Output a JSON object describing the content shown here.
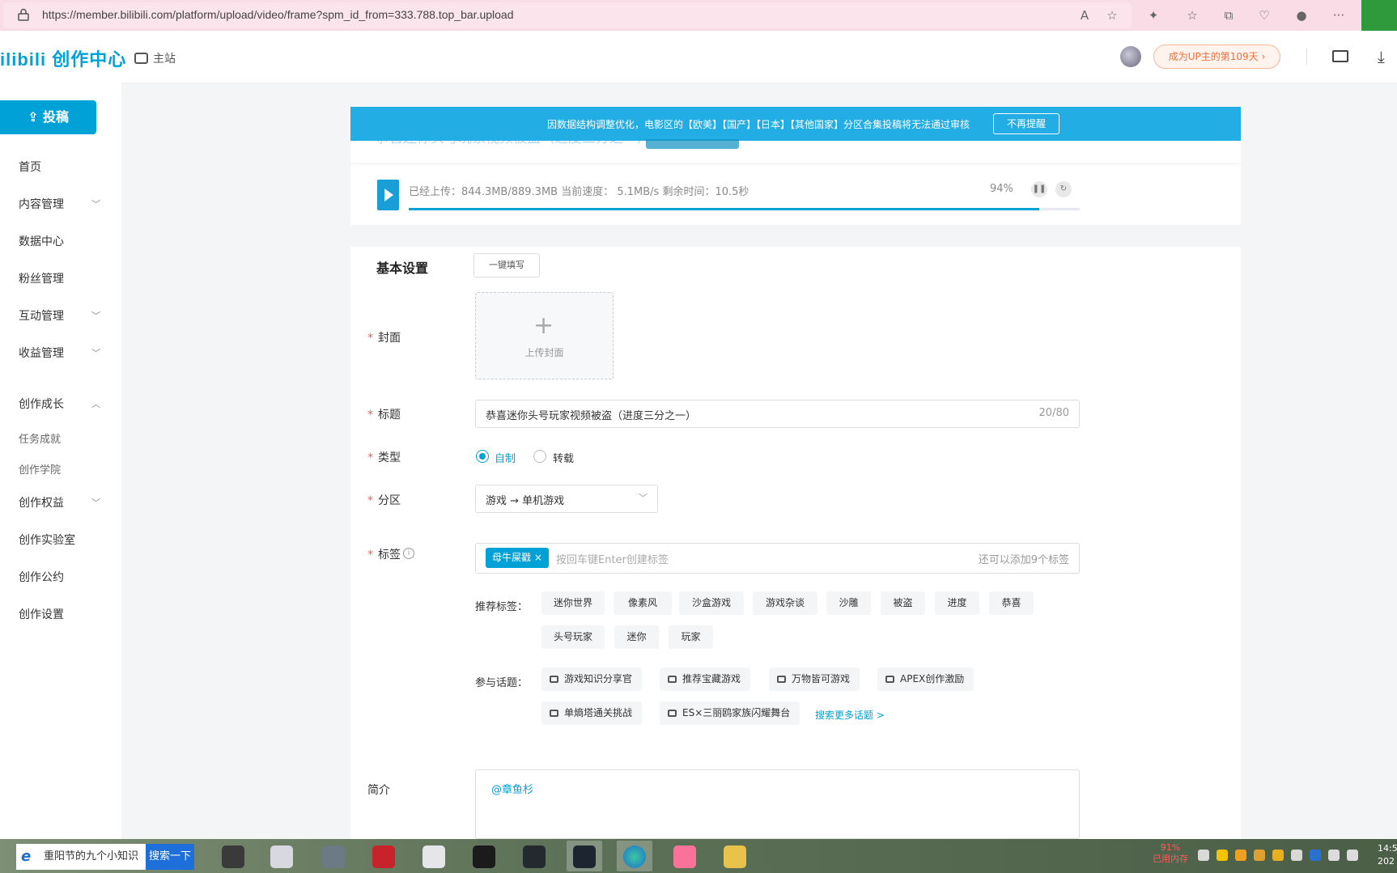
{
  "browser": {
    "url": "https://member.bilibili.com/platform/upload/video/frame?spm_id_from=333.788.top_bar.upload",
    "icons": [
      "read-aloud-icon",
      "add-favorite-icon",
      "extensions-icon",
      "favorites-icon",
      "collections-icon",
      "browser-essentials-icon",
      "profile-icon",
      "more-icon"
    ]
  },
  "header": {
    "logo": "ilibili 创作中心",
    "main_site": "主站",
    "up_badge": "成为UP主的第109天 ›"
  },
  "sidebar": {
    "upload_label": "投稿",
    "items": [
      {
        "label": "首页"
      },
      {
        "label": "内容管理"
      },
      {
        "label": "数据中心"
      },
      {
        "label": "粉丝管理"
      },
      {
        "label": "互动管理"
      },
      {
        "label": "收益管理"
      },
      {
        "label": "创作成长"
      },
      {
        "label": "任务成就"
      },
      {
        "label": "创作学院"
      },
      {
        "label": "创作权益"
      },
      {
        "label": "创作实验室"
      },
      {
        "label": "创作公约"
      },
      {
        "label": "创作设置"
      }
    ]
  },
  "notice": {
    "text": "因数据结构调整优化，电影区的【欧美】【国产】【日本】【其他国家】分区合集投稿将无法通过审核",
    "dismiss": "不再提醒",
    "ghost_title": "恭喜迷你头号玩家视频被盗（进度三分之一）"
  },
  "upload": {
    "status": "已经上传：844.3MB/889.3MB  当前速度： 5.1MB/s  剩余时间：10.5秒",
    "percent_label": "94%",
    "progress": 0.94
  },
  "form": {
    "section_title": "基本设置",
    "autofill": "一键填写",
    "cover_label": "封面",
    "cover_upload": "上传封面",
    "title_label": "标题",
    "title_value": "恭喜迷你头号玩家视频被盗（进度三分之一）",
    "title_count": "20/80",
    "type_label": "类型",
    "type_options": [
      "自制",
      "转载"
    ],
    "category_label": "分区",
    "category_value": "游戏 → 单机游戏",
    "tags_label": "标签",
    "tag_chip": "母牛屎戳 ×",
    "tag_placeholder": "按回车键Enter创建标签",
    "tag_remaining": "还可以添加9个标签",
    "recommended_label": "推荐标签：",
    "recommended": [
      "迷你世界",
      "像素风",
      "沙盒游戏",
      "游戏杂谈",
      "沙雕",
      "被盗",
      "进度",
      "恭喜",
      "头号玩家",
      "迷你",
      "玩家"
    ],
    "topics_label": "参与话题：",
    "topics": [
      "游戏知识分享官",
      "推荐宝藏游戏",
      "万物皆可游戏",
      "APEX创作激励",
      "单熵塔通关挑战",
      "ES×三丽鸥家族闪耀舞台"
    ],
    "more_topics": "搜索更多话题 >",
    "desc_label": "简介",
    "desc_value": "@章鱼杉"
  },
  "taskbar": {
    "search_value": "重阳节的九个小知识",
    "search_btn": "搜索一下",
    "mem_pct": "91%",
    "mem_label": "已用内存",
    "clock_time": "14:5",
    "clock_date": "202"
  }
}
